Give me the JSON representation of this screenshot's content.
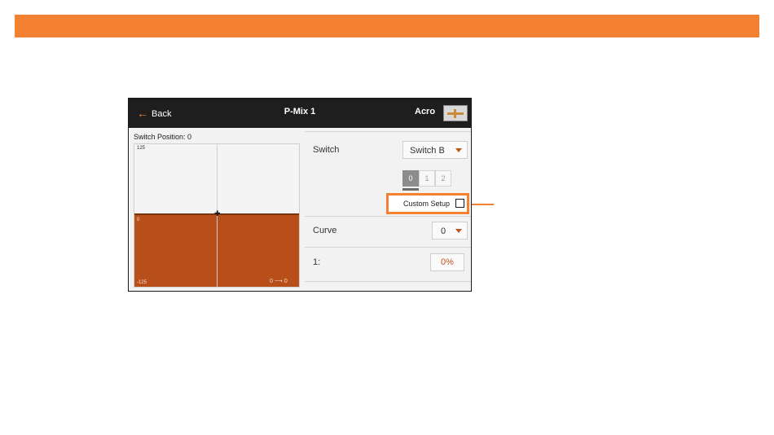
{
  "colors": {
    "accent": "#f48131",
    "graph_fill": "#b84f1a",
    "caret": "#c0521a"
  },
  "topbar": {
    "back_label": "Back",
    "back_icon": "arrow-left-icon",
    "title": "P-Mix 1",
    "model_type": "Acro",
    "model_icon": "airplane-icon"
  },
  "graph": {
    "switch_position_label": "Switch Position: 0",
    "y_top_tick": "125",
    "y_mid_tick": "0",
    "y_bottom_tick": "-125",
    "io_readout": "0 ⟶ 0"
  },
  "settings": {
    "switch_label": "Switch",
    "switch_value": "Switch B",
    "positions": [
      "0",
      "1",
      "2"
    ],
    "active_position": "0",
    "custom_setup_label": "Custom Setup",
    "custom_setup_checked": false,
    "curve_label": "Curve",
    "curve_value": "0",
    "point_label": "1:",
    "point_value": "0%"
  }
}
